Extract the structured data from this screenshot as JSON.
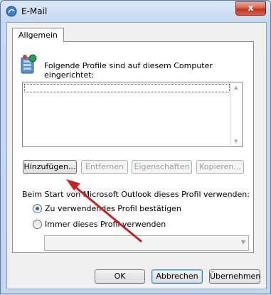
{
  "window": {
    "title": "E-Mail",
    "close_glyph": "x"
  },
  "tabs": [
    {
      "label": "Allgemein",
      "selected": true
    }
  ],
  "profiles": {
    "intro_text": "Folgende Profile sind auf diesem Computer eingerichtet:",
    "items": []
  },
  "profile_buttons": {
    "add": "Hinzufügen...",
    "remove": "Entfernen",
    "properties": "Eigenschaften",
    "copy": "Kopieren..."
  },
  "startup": {
    "label": "Beim Start von Microsoft Outlook dieses Profil verwenden:",
    "option_confirm": "Zu verwendendes Profil bestätigen",
    "option_always": "Immer dieses Profil verwenden",
    "selected_option": "confirm",
    "profile_dropdown_value": ""
  },
  "dialog_buttons": {
    "ok": "OK",
    "cancel": "Abbrechen",
    "apply": "Übernehmen"
  },
  "annotation": {
    "color": "#cc1f1f",
    "points_to": "add"
  },
  "icons": {
    "app": "mail-icon",
    "profiles": "profiles-icon"
  }
}
